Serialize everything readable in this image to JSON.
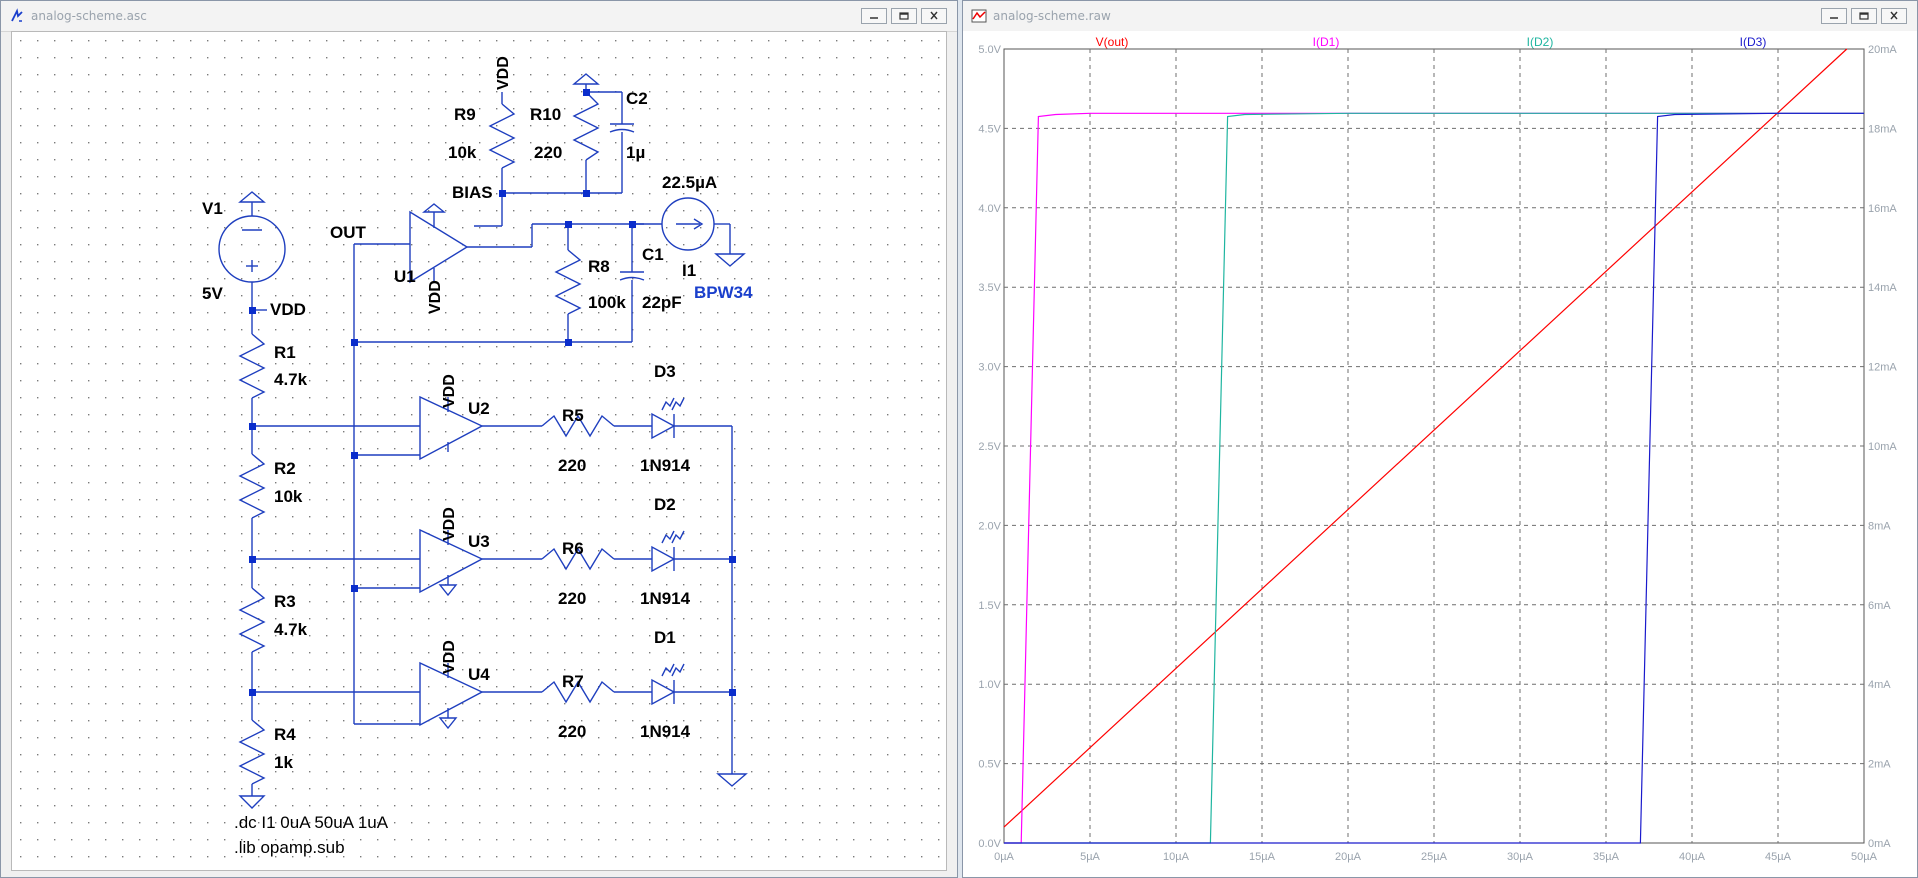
{
  "schematic_window": {
    "title": "analog-scheme.asc",
    "labels": {
      "V1": "V1",
      "V1_value": "5V",
      "VDD_node": "VDD",
      "R1": "R1",
      "R1_value": "4.7k",
      "R2": "R2",
      "R2_value": "10k",
      "R3": "R3",
      "R3_value": "4.7k",
      "R4": "R4",
      "R4_value": "1k",
      "R9": "R9",
      "R9_value": "10k",
      "R10": "R10",
      "R10_value": "220",
      "R8": "R8",
      "R8_value": "100k",
      "C2": "C2",
      "C2_value": "1µ",
      "C1": "C1",
      "C1_value": "22pF",
      "I1": "I1",
      "I1_value": "22.5µA",
      "I1_model": "BPW34",
      "BIAS": "BIAS",
      "OUT": "OUT",
      "U1": "U1",
      "U2": "U2",
      "U3": "U3",
      "U4": "U4",
      "VDD": "VDD",
      "R5": "R5",
      "R5_value": "220",
      "R6": "R6",
      "R6_value": "220",
      "R7": "R7",
      "R7_value": "220",
      "D1": "D1",
      "D2": "D2",
      "D3": "D3",
      "diode_model": "1N914"
    },
    "directives": [
      ".dc I1 0uA 50uA 1uA",
      ".lib opamp.sub"
    ]
  },
  "plot_window": {
    "title": "analog-scheme.raw"
  },
  "colors": {
    "wire": "#1f3fbf",
    "node": "#0a2dcc",
    "vout": "#ff0000",
    "id1": "#ff00ff",
    "id2": "#1fb5a0",
    "id3": "#1a1acc",
    "grid": "#6f6f6f"
  },
  "chart_data": {
    "type": "line",
    "x": [
      0,
      1,
      2,
      3,
      4,
      5,
      6,
      7,
      8,
      9,
      10,
      11,
      12,
      13,
      14,
      15,
      16,
      17,
      18,
      19,
      20,
      21,
      22,
      23,
      24,
      25,
      26,
      27,
      28,
      29,
      30,
      31,
      32,
      33,
      34,
      35,
      36,
      37,
      38,
      39,
      40,
      41,
      42,
      43,
      44,
      45,
      46,
      47,
      48,
      49,
      50
    ],
    "x_ticks": [
      "0µA",
      "5µA",
      "10µA",
      "15µA",
      "20µA",
      "25µA",
      "30µA",
      "35µA",
      "40µA",
      "45µA",
      "50µA"
    ],
    "y_left_ticks": [
      "0.0V",
      "0.5V",
      "1.0V",
      "1.5V",
      "2.0V",
      "2.5V",
      "3.0V",
      "3.5V",
      "4.0V",
      "4.5V",
      "5.0V"
    ],
    "y_right_ticks": [
      "0mA",
      "2mA",
      "4mA",
      "6mA",
      "8mA",
      "10mA",
      "12mA",
      "14mA",
      "16mA",
      "18mA",
      "20mA"
    ],
    "xlim": [
      0,
      50
    ],
    "ylim_left": [
      0,
      5
    ],
    "ylim_right": [
      0,
      20
    ],
    "grid": true,
    "series": [
      {
        "name": "V(out)",
        "axis": "left",
        "x": [
          0,
          49
        ],
        "y": [
          0.1,
          5.0
        ]
      },
      {
        "name": "I(D1)",
        "axis": "right",
        "x": [
          0,
          1,
          2,
          3,
          5,
          10,
          20,
          30,
          40,
          50
        ],
        "y": [
          0,
          0,
          18.3,
          18.35,
          18.38,
          18.38,
          18.38,
          18.38,
          18.38,
          18.38
        ]
      },
      {
        "name": "I(D2)",
        "axis": "right",
        "x": [
          0,
          12,
          13,
          14,
          20,
          30,
          40,
          50
        ],
        "y": [
          0,
          0,
          18.3,
          18.35,
          18.38,
          18.38,
          18.38,
          18.38
        ]
      },
      {
        "name": "I(D3)",
        "axis": "right",
        "x": [
          0,
          37,
          38,
          39,
          45,
          50
        ],
        "y": [
          0,
          0,
          18.3,
          18.35,
          18.38,
          18.38
        ]
      }
    ]
  }
}
